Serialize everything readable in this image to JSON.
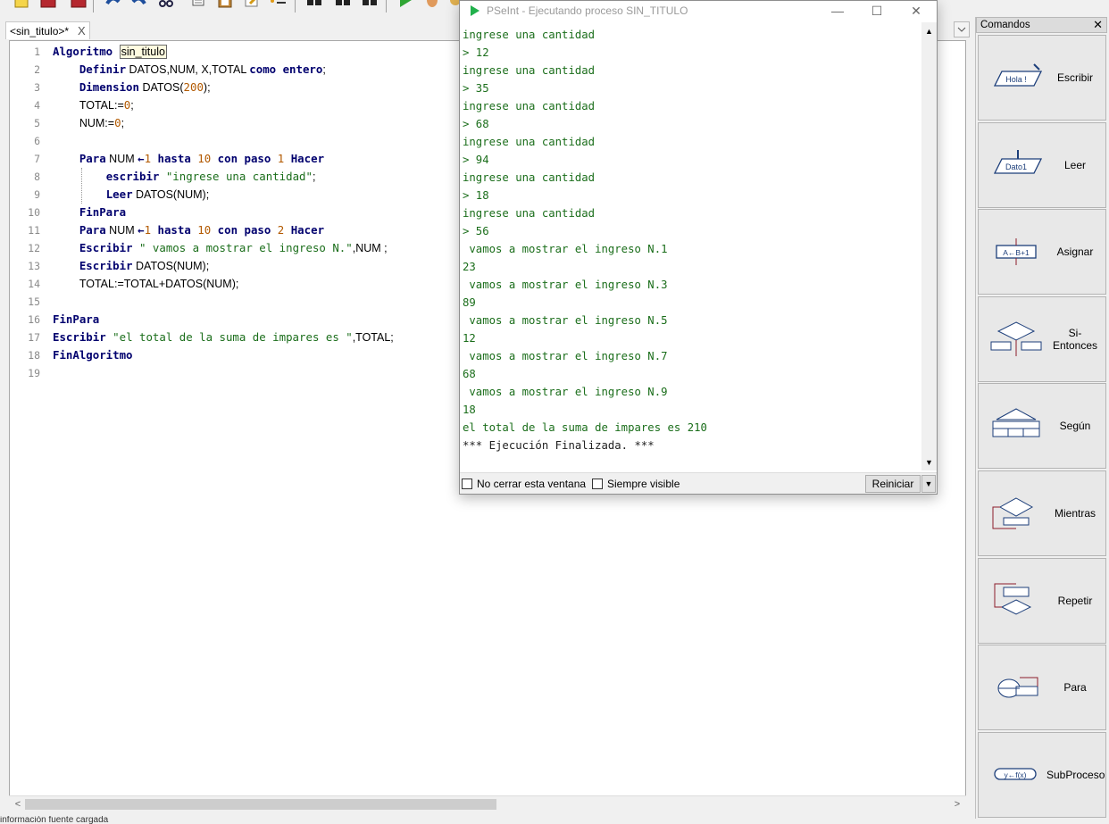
{
  "editor": {
    "tab_label": "<sin_titulo>*",
    "tab_close": "X",
    "dropdown_glyph": "⌄",
    "lines": [
      {
        "n": "1",
        "tokens": [
          [
            "kw",
            "Algoritmo"
          ],
          [
            "op",
            " "
          ],
          [
            "name",
            "sin_titulo"
          ]
        ]
      },
      {
        "n": "2",
        "tokens": [
          [
            "op",
            "    "
          ],
          [
            "kw",
            "Definir"
          ],
          [
            "id",
            " DATOS,NUM, X,TOTAL "
          ],
          [
            "kw",
            "como entero"
          ],
          [
            "id",
            ";"
          ]
        ]
      },
      {
        "n": "3",
        "tokens": [
          [
            "op",
            "    "
          ],
          [
            "kw",
            "Dimension"
          ],
          [
            "id",
            " DATOS("
          ],
          [
            "num",
            "200"
          ],
          [
            "id",
            ");"
          ]
        ]
      },
      {
        "n": "4",
        "tokens": [
          [
            "op",
            "    "
          ],
          [
            "id",
            "TOTAL:="
          ],
          [
            "num",
            "0"
          ],
          [
            "id",
            ";"
          ]
        ]
      },
      {
        "n": "5",
        "tokens": [
          [
            "op",
            "    "
          ],
          [
            "id",
            "NUM:="
          ],
          [
            "num",
            "0"
          ],
          [
            "id",
            ";"
          ]
        ]
      },
      {
        "n": "6",
        "tokens": []
      },
      {
        "n": "7",
        "tokens": [
          [
            "op",
            "    "
          ],
          [
            "kw",
            "Para"
          ],
          [
            "id",
            " NUM "
          ],
          [
            "kw",
            "←"
          ],
          [
            "num",
            "1"
          ],
          [
            "kw",
            " hasta "
          ],
          [
            "num",
            "10"
          ],
          [
            "kw",
            " con paso "
          ],
          [
            "num",
            "1"
          ],
          [
            "kw",
            " Hacer"
          ]
        ]
      },
      {
        "n": "8",
        "tokens": [
          [
            "op",
            "        "
          ],
          [
            "kw",
            "escribir"
          ],
          [
            "str",
            " \"ingrese una cantidad\""
          ],
          [
            "id",
            ";"
          ]
        ]
      },
      {
        "n": "9",
        "tokens": [
          [
            "op",
            "        "
          ],
          [
            "kw",
            "Leer"
          ],
          [
            "id",
            " DATOS(NUM);"
          ]
        ]
      },
      {
        "n": "10",
        "tokens": [
          [
            "op",
            "    "
          ],
          [
            "kw",
            "FinPara"
          ]
        ]
      },
      {
        "n": "11",
        "tokens": [
          [
            "op",
            "    "
          ],
          [
            "kw",
            "Para"
          ],
          [
            "id",
            " NUM "
          ],
          [
            "kw",
            "←"
          ],
          [
            "num",
            "1"
          ],
          [
            "kw",
            " hasta "
          ],
          [
            "num",
            "10"
          ],
          [
            "kw",
            " con paso "
          ],
          [
            "num",
            "2"
          ],
          [
            "kw",
            " Hacer"
          ]
        ]
      },
      {
        "n": "12",
        "tokens": [
          [
            "op",
            "    "
          ],
          [
            "kw",
            "Escribir"
          ],
          [
            "str",
            " \" vamos a mostrar el ingreso N.\""
          ],
          [
            "id",
            ",NUM ;"
          ]
        ]
      },
      {
        "n": "13",
        "tokens": [
          [
            "op",
            "    "
          ],
          [
            "kw",
            "Escribir"
          ],
          [
            "id",
            " DATOS(NUM);"
          ]
        ]
      },
      {
        "n": "14",
        "tokens": [
          [
            "op",
            "    "
          ],
          [
            "id",
            "TOTAL:=TOTAL+DATOS(NUM);"
          ]
        ]
      },
      {
        "n": "15",
        "tokens": []
      },
      {
        "n": "16",
        "tokens": [
          [
            "kw",
            "FinPara"
          ]
        ]
      },
      {
        "n": "17",
        "tokens": [
          [
            "kw",
            "Escribir"
          ],
          [
            "str",
            " \"el total de la suma de impares es \""
          ],
          [
            "id",
            ",TOTAL;"
          ]
        ]
      },
      {
        "n": "18",
        "tokens": [
          [
            "kw",
            "FinAlgoritmo"
          ]
        ]
      },
      {
        "n": "19",
        "tokens": []
      }
    ]
  },
  "status_text": "información fuente cargada",
  "commands_panel": {
    "title": "Comandos",
    "close": "✕",
    "items": [
      {
        "label": "Escribir",
        "icon": "escribir-icon"
      },
      {
        "label": "Leer",
        "icon": "leer-icon"
      },
      {
        "label": "Asignar",
        "icon": "asignar-icon"
      },
      {
        "label": "Si-Entonces",
        "icon": "si-entonces-icon"
      },
      {
        "label": "Según",
        "icon": "segun-icon"
      },
      {
        "label": "Mientras",
        "icon": "mientras-icon"
      },
      {
        "label": "Repetir",
        "icon": "repetir-icon"
      },
      {
        "label": "Para",
        "icon": "para-icon"
      },
      {
        "label": "SubProceso",
        "icon": "subproceso-icon"
      }
    ],
    "icon_texts": {
      "escribir": "Hola !",
      "leer": "Dato1",
      "asignar": "A←B+1",
      "subproceso": "y←f(x)"
    }
  },
  "output_window": {
    "title": "PSeInt - Ejecutando proceso SIN_TITULO",
    "minimize": "—",
    "maximize": "☐",
    "close": "✕",
    "lines": [
      {
        "text": "ingrese una cantidad",
        "color": "green"
      },
      {
        "text": "> 12",
        "color": "green"
      },
      {
        "text": "ingrese una cantidad",
        "color": "green"
      },
      {
        "text": "> 35",
        "color": "green"
      },
      {
        "text": "ingrese una cantidad",
        "color": "green"
      },
      {
        "text": "> 68",
        "color": "green"
      },
      {
        "text": "ingrese una cantidad",
        "color": "green"
      },
      {
        "text": "> 94",
        "color": "green"
      },
      {
        "text": "ingrese una cantidad",
        "color": "green"
      },
      {
        "text": "> 18",
        "color": "green"
      },
      {
        "text": "ingrese una cantidad",
        "color": "green"
      },
      {
        "text": "> 56",
        "color": "green"
      },
      {
        "text": " vamos a mostrar el ingreso N.1",
        "color": "green"
      },
      {
        "text": "23",
        "color": "green"
      },
      {
        "text": " vamos a mostrar el ingreso N.3",
        "color": "green"
      },
      {
        "text": "89",
        "color": "green"
      },
      {
        "text": " vamos a mostrar el ingreso N.5",
        "color": "green"
      },
      {
        "text": "12",
        "color": "green"
      },
      {
        "text": " vamos a mostrar el ingreso N.7",
        "color": "green"
      },
      {
        "text": "68",
        "color": "green"
      },
      {
        "text": " vamos a mostrar el ingreso N.9",
        "color": "green"
      },
      {
        "text": "18",
        "color": "green"
      },
      {
        "text": "el total de la suma de impares es 210",
        "color": "green"
      },
      {
        "text": "*** Ejecución Finalizada. ***",
        "color": "black"
      }
    ],
    "chk_no_cerrar": "No cerrar esta ventana",
    "chk_siempre_visible": "Siempre visible",
    "btn_reiniciar": "Reiniciar"
  },
  "colors": {
    "keyword": "#00006e",
    "number": "#b25900",
    "string": "#1b6e1b",
    "output_green": "#1b6e1b",
    "pseint_logo": "#22b14c"
  }
}
